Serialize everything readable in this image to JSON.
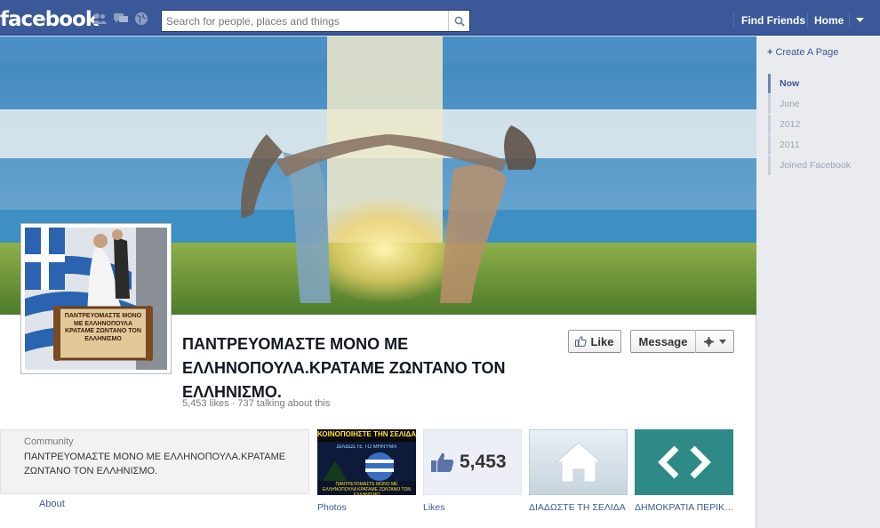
{
  "topbar": {
    "logo": "facebook",
    "search": {
      "placeholder": "Search for people, places and things"
    },
    "links": {
      "find_friends": "Find Friends",
      "home": "Home"
    }
  },
  "page": {
    "title": "ΠΑΝΤΡΕΥΟΜΑΣΤΕ ΜΟΝΟ ΜΕ ΕΛΛΗΝΟΠΟΥΛΑ.ΚΡΑΤΑΜΕ ΖΩΝΤΑΝΟ ΤΟΝ ΕΛΛΗΝΙΣΜΟ.",
    "stats": "5,453 likes · 737 talking about this",
    "profile_scroll_text": "ΠΑΝΤΡΕΥΟΜΑΣΤΕ ΜΟΝΟ ΜΕ ΕΛΛΗΝΟΠΟΥΛΑ ΚΡΑΤΑΜΕ ΖΩΝΤΑΝΟ ΤΟΝ ΕΛΛΗΝΙΣΜΟ"
  },
  "actions": {
    "like": "Like",
    "message": "Message"
  },
  "about": {
    "category": "Community",
    "description": "ΠΑΝΤΡΕΥΟΜΑΣΤΕ ΜΟΝΟ ΜΕ ΕΛΛΗΝΟΠΟΥΛΑ.ΚΡΑΤΑΜΕ ΖΩΝΤΑΝΟ ΤΟΝ ΕΛΛΗΝΙΣΜΟ.",
    "link": "About"
  },
  "tiles": {
    "photos": {
      "label": "Photos",
      "banner": "ΚΟΙΝΟΠΟΙΗΣΤΕ ΤΗΝ ΣΕΛΙΔΑ",
      "sub": "ΔΙΑΔΩΣΤΕ ΤΟ ΜΗΝΥΜΑ",
      "caption": "ΠΑΝΤΡΕΥΟΜΑΣΤΕ ΜΟΝΟ ΜΕ ΕΛΛΗΝΟΠΟΥΛΑ ΚΡΑΤΑΜΕ ΖΩΝΤΑΝΟ ΤΟΝ ΕΛΛΗΝΙΣΜΟ"
    },
    "likes": {
      "label": "Likes",
      "count": "5,453"
    },
    "app1": {
      "label": "ΔΙΑΔΩΣΤΕ ΤΗ ΣΕΛΙΔΑ"
    },
    "app2": {
      "label": "ΔΗΜΟΚΡΑΤΙΑ ΠΕΡΙΚ…"
    }
  },
  "sidebar": {
    "create_page": "Create A Page",
    "timeline": [
      "Now",
      "June",
      "2012",
      "2011",
      "Joined Facebook"
    ]
  },
  "colors": {
    "brand": "#3b5998",
    "app2_teal": "#2d8a87"
  },
  "icons": [
    "friend-requests-icon",
    "messages-icon",
    "notifications-globe-icon",
    "search-icon",
    "dropdown-arrow-icon",
    "like-thumb-icon",
    "gear-icon",
    "plus-icon",
    "home-icon",
    "code-brackets-icon"
  ]
}
